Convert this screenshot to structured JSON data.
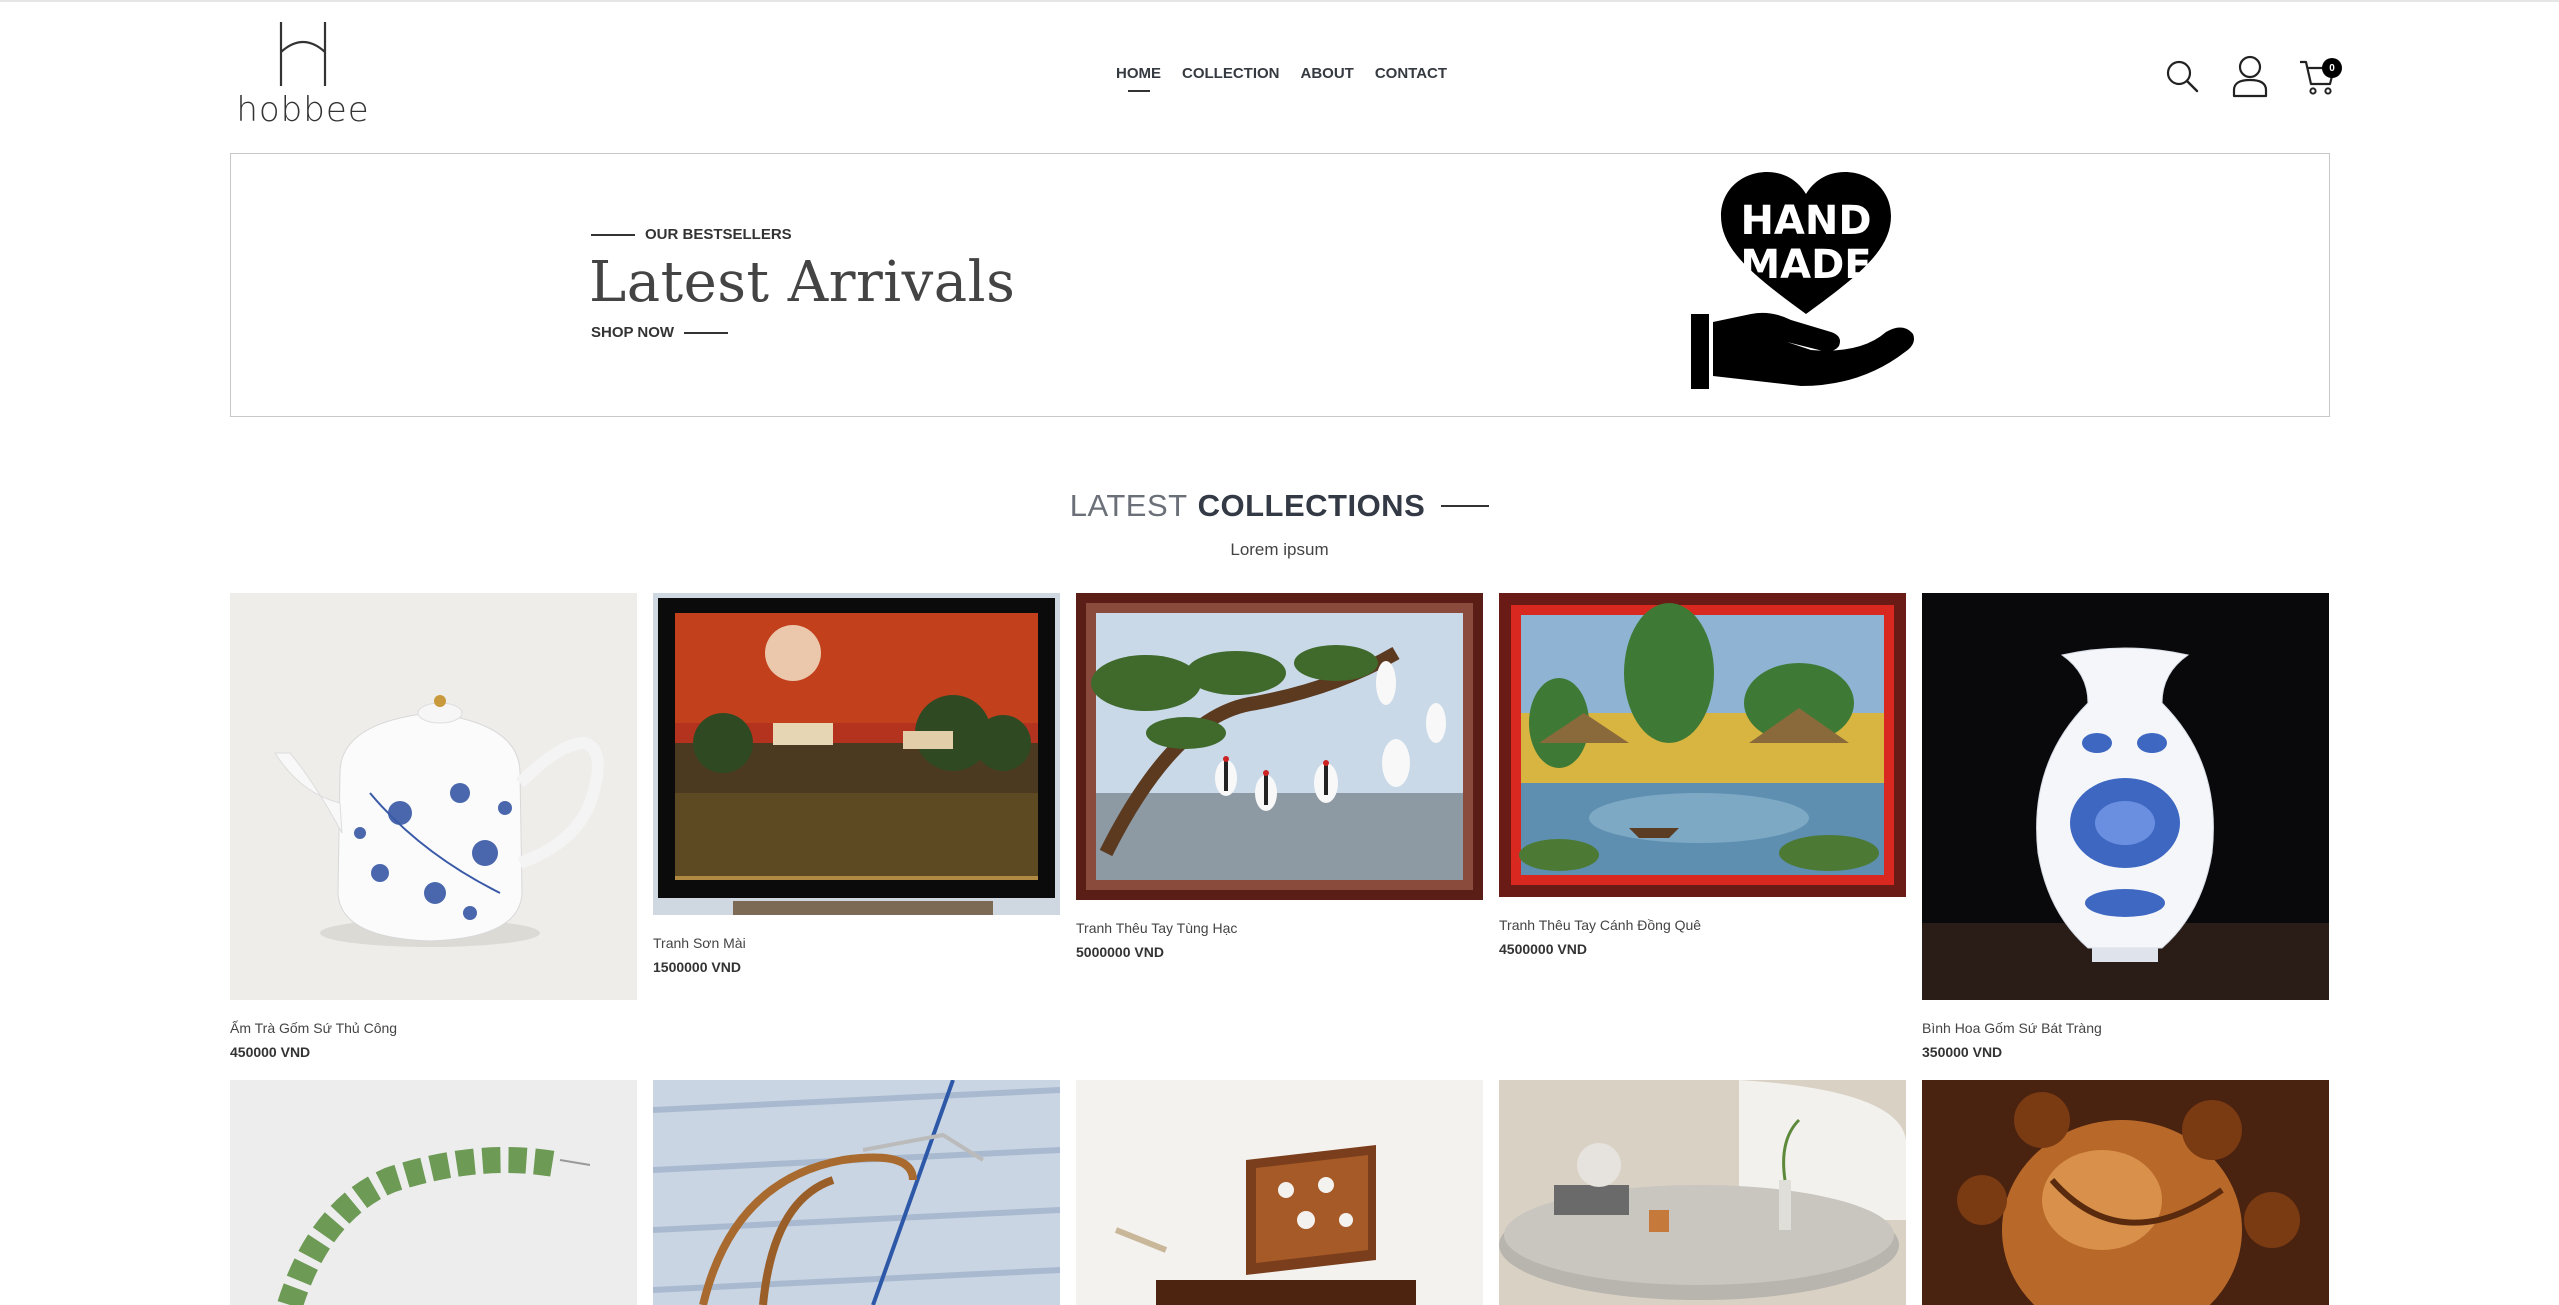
{
  "brand": {
    "name": "hobbee"
  },
  "nav": [
    {
      "label": "HOME",
      "active": true
    },
    {
      "label": "COLLECTION",
      "active": false
    },
    {
      "label": "ABOUT",
      "active": false
    },
    {
      "label": "CONTACT",
      "active": false
    }
  ],
  "header_icons": [
    "search-icon",
    "user-icon",
    "cart-icon"
  ],
  "cart": {
    "count": "0"
  },
  "hero": {
    "eyebrow": "OUR BESTSELLERS",
    "title": "Latest Arrivals",
    "cta": "SHOP NOW",
    "badge_line1": "HAND",
    "badge_line2": "MADE"
  },
  "section": {
    "title_light": "LATEST",
    "title_bold": "COLLECTIONS",
    "subtitle": "Lorem ipsum"
  },
  "products": [
    {
      "name": "Ấm Trà Gốm Sứ Thủ Công",
      "price": "450000 VND"
    },
    {
      "name": "Tranh Sơn Mài",
      "price": "1500000 VND"
    },
    {
      "name": "Tranh Thêu Tay Tùng Hạc",
      "price": "5000000 VND"
    },
    {
      "name": "Tranh Thêu Tay Cánh Đồng Quê",
      "price": "4500000 VND"
    },
    {
      "name": "Bình Hoa Gốm Sứ Bát Tràng",
      "price": "350000 VND"
    }
  ],
  "colors": {
    "text": "#333333",
    "border": "#c8c8c8",
    "badge": "#000000"
  }
}
